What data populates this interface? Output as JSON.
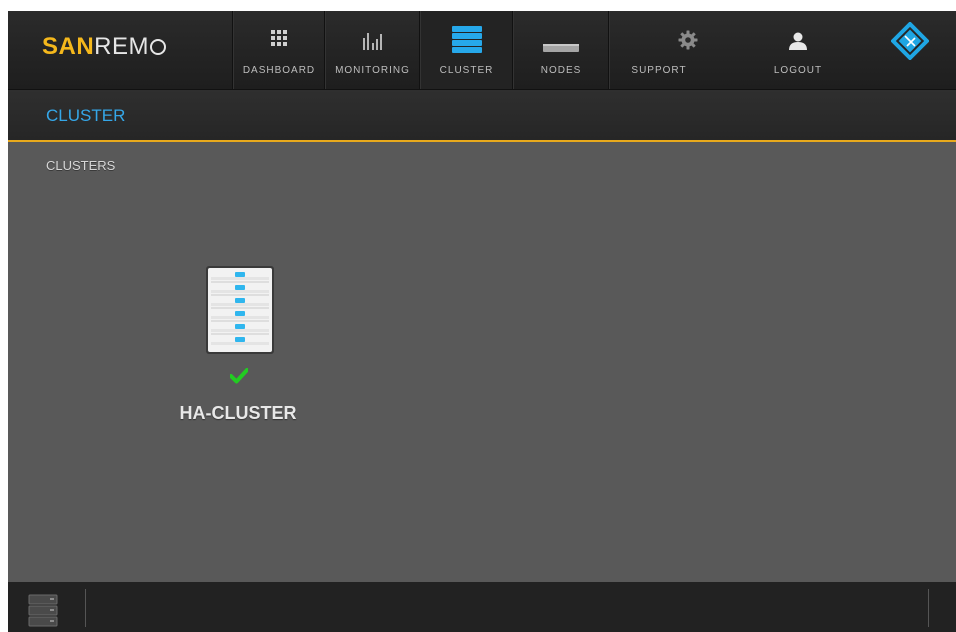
{
  "brand": {
    "logo_bold": "SAN",
    "logo_light": "REM"
  },
  "nav": {
    "items": [
      {
        "label": "DASHBOARD",
        "icon": "grid-icon"
      },
      {
        "label": "MONITORING",
        "icon": "bar-chart-icon"
      },
      {
        "label": "CLUSTER",
        "icon": "cluster-stack-icon",
        "active": true
      },
      {
        "label": "NODES",
        "icon": "node-icon"
      },
      {
        "label": "SUPPORT",
        "icon": "gear-icon"
      },
      {
        "label": "LOGOUT",
        "icon": "user-icon"
      }
    ]
  },
  "page": {
    "title": "CLUSTER"
  },
  "content": {
    "section_label": "CLUSTERS",
    "clusters": [
      {
        "name": "HA-CLUSTER",
        "status": "ok",
        "status_icon": "check-icon"
      }
    ]
  },
  "colors": {
    "accent": "#35a7e8",
    "logo": "#f5b81c",
    "divider": "#e8a91c",
    "status_ok": "#22cc22"
  }
}
